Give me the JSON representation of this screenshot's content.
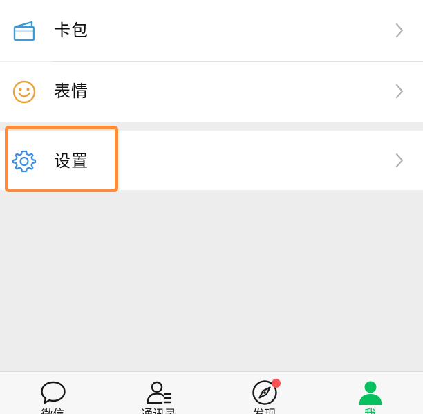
{
  "menu": {
    "items": [
      {
        "label": "卡包",
        "icon": "card-wallet-icon"
      },
      {
        "label": "表情",
        "icon": "smiley-icon"
      },
      {
        "label": "设置",
        "icon": "gear-icon"
      }
    ]
  },
  "tabbar": {
    "tabs": [
      {
        "label": "微信",
        "icon": "chat-bubble-icon",
        "active": false
      },
      {
        "label": "通讯录",
        "icon": "contacts-icon",
        "active": false
      },
      {
        "label": "发现",
        "icon": "compass-icon",
        "active": false,
        "badge": "red-dot"
      },
      {
        "label": "我",
        "icon": "person-icon",
        "active": true
      }
    ]
  },
  "colors": {
    "accent": "#07c160",
    "highlight": "#ff8c3a",
    "badge": "#fa5151",
    "card_icon": "#3a9bd8",
    "smiley_icon": "#e8a33c",
    "gear_icon": "#3a8ee6"
  }
}
